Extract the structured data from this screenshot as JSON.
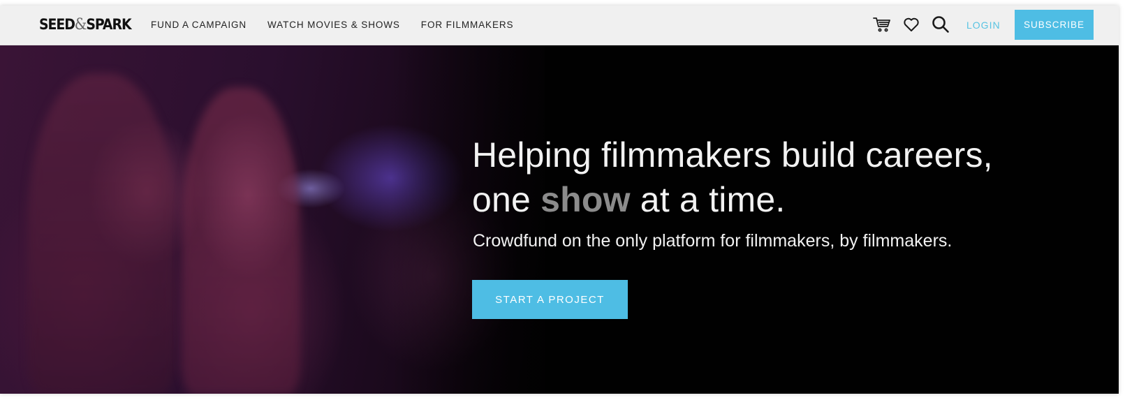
{
  "brand": {
    "logo_left": "SEED",
    "logo_amp": "&",
    "logo_right": "SPARK"
  },
  "nav": {
    "links": [
      {
        "label": "FUND A CAMPAIGN"
      },
      {
        "label": "WATCH MOVIES & SHOWS"
      },
      {
        "label": "FOR FILMMAKERS"
      }
    ],
    "icons": [
      "cart-icon",
      "heart-icon",
      "search-icon"
    ],
    "login_label": "LOGIN",
    "subscribe_label": "SUBSCRIBE"
  },
  "hero": {
    "headline_line1": "Helping filmmakers build careers,",
    "headline_line2_pre": "one ",
    "headline_line2_em": "show",
    "headline_line2_post": " at a time.",
    "subheadline": "Crowdfund on the only platform for filmmakers, by filmmakers.",
    "cta_label": "START A PROJECT"
  },
  "colors": {
    "accent": "#4ebde4",
    "login": "#58c3e2",
    "navbar_bg": "#f0f0f0",
    "hero_bg": "#010101",
    "headline_emphasis": "#8c8c8c"
  }
}
